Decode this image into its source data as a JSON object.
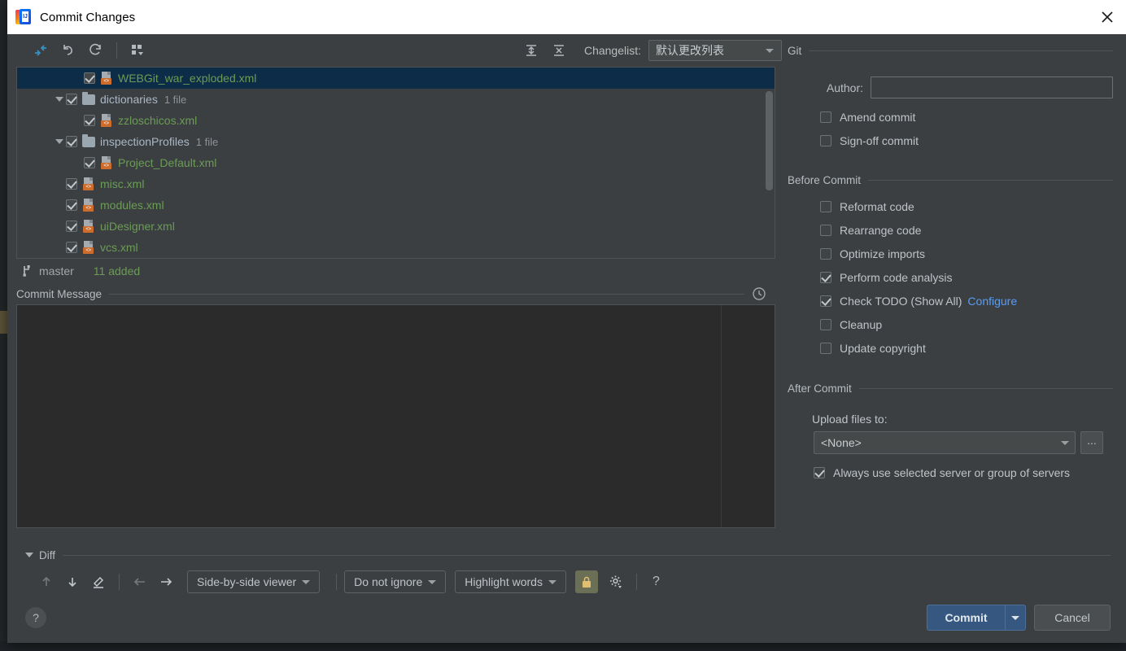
{
  "window": {
    "title": "Commit Changes",
    "logo_text": "IJ",
    "close_icon": "close-icon"
  },
  "toolbar": {
    "buttons": [
      {
        "name": "show-diff-button",
        "icon": "arrows-collapse-icon"
      },
      {
        "name": "revert-button",
        "icon": "undo-arrow-icon"
      },
      {
        "name": "refresh-button",
        "icon": "refresh-icon"
      },
      {
        "name": "group-by-button",
        "icon": "group-by-grid-icon"
      }
    ],
    "expand_all": {
      "name": "expand-all-button",
      "icon": "expand-all-icon"
    },
    "collapse_all": {
      "name": "collapse-all-button",
      "icon": "collapse-all-icon"
    },
    "changelist_label": "Changelist:",
    "changelist_value": "默认更改列表"
  },
  "tree": {
    "rows": [
      {
        "indent": 3,
        "twisty": false,
        "checked": true,
        "icon": "xml-file-icon",
        "name": "WEBGit_war_exploded.xml",
        "color": "green",
        "count": "",
        "selected": true
      },
      {
        "indent": 2,
        "twisty": true,
        "checked": true,
        "icon": "folder-icon",
        "name": "dictionaries",
        "color": "plain",
        "count": "1 file",
        "selected": false
      },
      {
        "indent": 3,
        "twisty": false,
        "checked": true,
        "icon": "xml-file-icon",
        "name": "zzloschicos.xml",
        "color": "green",
        "count": "",
        "selected": false
      },
      {
        "indent": 2,
        "twisty": true,
        "checked": true,
        "icon": "folder-icon",
        "name": "inspectionProfiles",
        "color": "plain",
        "count": "1 file",
        "selected": false
      },
      {
        "indent": 3,
        "twisty": false,
        "checked": true,
        "icon": "xml-file-icon",
        "name": "Project_Default.xml",
        "color": "green",
        "count": "",
        "selected": false
      },
      {
        "indent": 2,
        "twisty": false,
        "checked": true,
        "icon": "xml-file-icon",
        "name": "misc.xml",
        "color": "green",
        "count": "",
        "selected": false
      },
      {
        "indent": 2,
        "twisty": false,
        "checked": true,
        "icon": "xml-file-icon",
        "name": "modules.xml",
        "color": "green",
        "count": "",
        "selected": false
      },
      {
        "indent": 2,
        "twisty": false,
        "checked": true,
        "icon": "xml-file-icon",
        "name": "uiDesigner.xml",
        "color": "green",
        "count": "",
        "selected": false
      },
      {
        "indent": 2,
        "twisty": false,
        "checked": true,
        "icon": "xml-file-icon",
        "name": "vcs.xml",
        "color": "green",
        "count": "",
        "selected": false
      }
    ],
    "xml_badge": "<>"
  },
  "status": {
    "branch_icon": "git-branch-icon",
    "branch": "master",
    "added": "11 added"
  },
  "commit_message": {
    "title": "Commit Message",
    "value": "",
    "history_icon": "clock-history-icon"
  },
  "git_section": {
    "title": "Git",
    "author_label": "Author:",
    "author_value": "",
    "options": [
      {
        "label": "Amend commit",
        "checked": false,
        "name": "amend-commit-checkbox"
      },
      {
        "label": "Sign-off commit",
        "checked": false,
        "name": "sign-off-commit-checkbox"
      }
    ]
  },
  "before_commit": {
    "title": "Before Commit",
    "options": [
      {
        "label": "Reformat code",
        "checked": false,
        "name": "reformat-code-checkbox",
        "link": ""
      },
      {
        "label": "Rearrange code",
        "checked": false,
        "name": "rearrange-code-checkbox",
        "link": ""
      },
      {
        "label": "Optimize imports",
        "checked": false,
        "name": "optimize-imports-checkbox",
        "link": ""
      },
      {
        "label": "Perform code analysis",
        "checked": true,
        "name": "perform-code-analysis-checkbox",
        "link": ""
      },
      {
        "label": "Check TODO (Show All)",
        "checked": true,
        "name": "check-todo-checkbox",
        "link": "Configure"
      },
      {
        "label": "Cleanup",
        "checked": false,
        "name": "cleanup-checkbox",
        "link": ""
      },
      {
        "label": "Update copyright",
        "checked": false,
        "name": "update-copyright-checkbox",
        "link": ""
      }
    ]
  },
  "after_commit": {
    "title": "After Commit",
    "upload_label": "Upload files to:",
    "upload_value": "<None>",
    "browse_label": "...",
    "always_use": {
      "label": "Always use selected server or group of servers",
      "checked": true
    }
  },
  "diff": {
    "title": "Diff",
    "buttons": [
      {
        "name": "previous-difference-button",
        "icon": "arrow-up-icon",
        "disabled": true
      },
      {
        "name": "next-difference-button",
        "icon": "arrow-down-icon",
        "disabled": false
      },
      {
        "name": "annotate-button",
        "icon": "pencil-icon",
        "disabled": false
      },
      {
        "name": "previous-file-button",
        "icon": "arrow-left-icon",
        "disabled": true
      },
      {
        "name": "next-file-button",
        "icon": "arrow-right-icon",
        "disabled": false
      }
    ],
    "viewer_mode": "Side-by-side viewer",
    "ignore_mode": "Do not ignore",
    "highlight_mode": "Highlight words",
    "lock_icon": "lock-icon",
    "settings_icon": "gear-icon",
    "help_label": "?"
  },
  "footer": {
    "help_label": "?",
    "commit_label": "Commit",
    "cancel_label": "Cancel"
  },
  "colors": {
    "accent": "#365880",
    "added_file": "#6a9c55",
    "link": "#589df6",
    "selection": "#0d2c47",
    "xml_badge": "#cc6d2e"
  }
}
